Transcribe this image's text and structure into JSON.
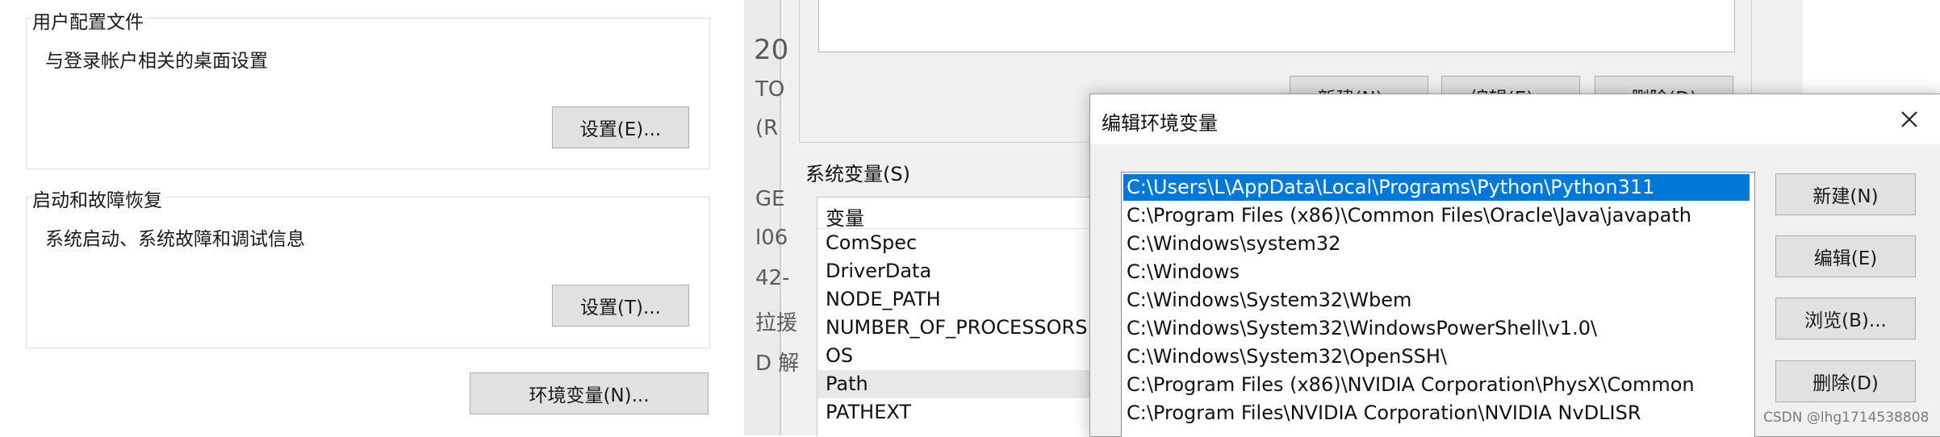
{
  "system_properties": {
    "user_profiles": {
      "title": "用户配置文件",
      "desc": "与登录帐户相关的桌面设置",
      "button": "设置(E)..."
    },
    "startup_recovery": {
      "title": "启动和故障恢复",
      "desc": "系统启动、系统故障和调试信息",
      "button": "设置(T)..."
    },
    "env_button": "环境变量(N)..."
  },
  "env_vars_dialog": {
    "top_buttons": [
      "新建(N)...",
      "编辑(E)...",
      "删除(D)"
    ],
    "system_vars_label": "系统变量(S)",
    "column_header": "变量",
    "variables": [
      "ComSpec",
      "DriverData",
      "NODE_PATH",
      "NUMBER_OF_PROCESSORS",
      "OS",
      "Path",
      "PATHEXT"
    ],
    "selected_variable": "Path",
    "cut_text": [
      "20",
      "TO",
      "(R",
      "GE",
      "l06",
      "42-",
      "拉援",
      "D 解"
    ]
  },
  "edit_dialog": {
    "title": "编辑环境变量",
    "paths": [
      "C:\\Users\\L\\AppData\\Local\\Programs\\Python\\Python311",
      "C:\\Program Files (x86)\\Common Files\\Oracle\\Java\\javapath",
      "C:\\Windows\\system32",
      "C:\\Windows",
      "C:\\Windows\\System32\\Wbem",
      "C:\\Windows\\System32\\WindowsPowerShell\\v1.0\\",
      "C:\\Windows\\System32\\OpenSSH\\",
      "C:\\Program Files (x86)\\NVIDIA Corporation\\PhysX\\Common",
      "C:\\Program Files\\NVIDIA Corporation\\NVIDIA NvDLISR"
    ],
    "selected_index": 0,
    "buttons": {
      "new": "新建(N)",
      "edit": "编辑(E)",
      "browse": "浏览(B)...",
      "delete": "删除(D)"
    }
  },
  "watermark": "CSDN @lhg1714538808",
  "colors": {
    "selection": "#0078d7",
    "dialog_bg": "#f0f0f0",
    "button_bg": "#e1e1e1"
  }
}
